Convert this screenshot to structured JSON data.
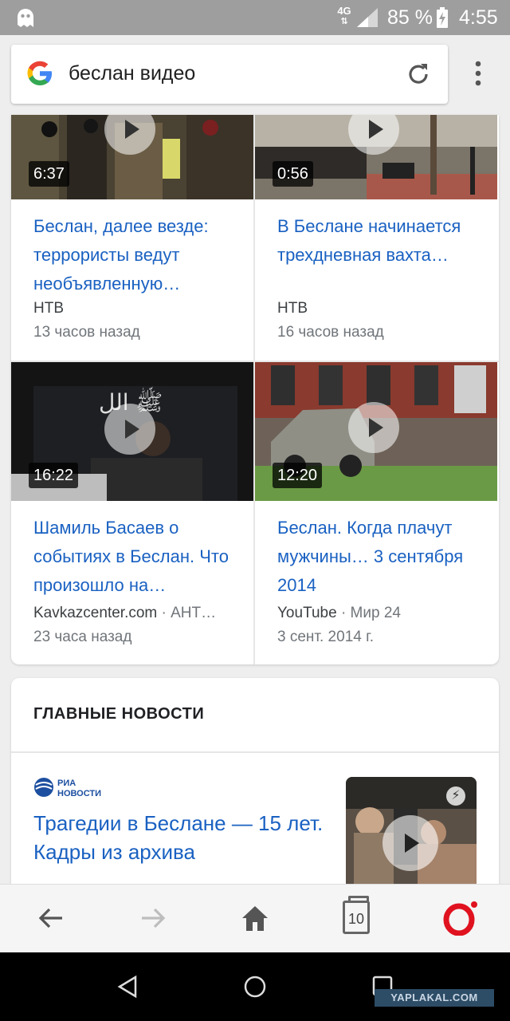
{
  "status_bar": {
    "network": "4G",
    "battery_percent": "85 %",
    "time": "4:55"
  },
  "search": {
    "query": "беслан видео"
  },
  "videos": [
    {
      "duration": "6:37",
      "title": "Беслан, далее везде: террористы ведут необъявленную…",
      "source": "НТВ",
      "source_extra": "",
      "time": "13 часов назад"
    },
    {
      "duration": "0:56",
      "title": "В Беслане начинается трехдневная вахта…",
      "source": "НТВ",
      "source_extra": "",
      "time": "16 часов назад"
    },
    {
      "duration": "16:22",
      "title": "Шамиль Басаев о событиях в Беслан. Что произошло на…",
      "source": "Kavkazcenter.com",
      "source_extra": " · АНТ…",
      "time": "23 часа назад"
    },
    {
      "duration": "12:20",
      "title": "Беслан. Когда плачут мужчины… 3 сентября 2014",
      "source": "YouTube",
      "source_extra": " · Мир 24",
      "time": "3 сент. 2014 г."
    }
  ],
  "top_news": {
    "heading": "ГЛАВНЫЕ НОВОСТИ",
    "publisher_logo": "РИА НОВОСТИ",
    "article_title": "Трагедии в Беслане — 15 лет. Кадры из архива"
  },
  "toolbar": {
    "tab_count": "10"
  },
  "watermark": "YAPLAKAL.COM",
  "colors": {
    "link": "#1a61c2",
    "opera_red": "#e0121f"
  }
}
